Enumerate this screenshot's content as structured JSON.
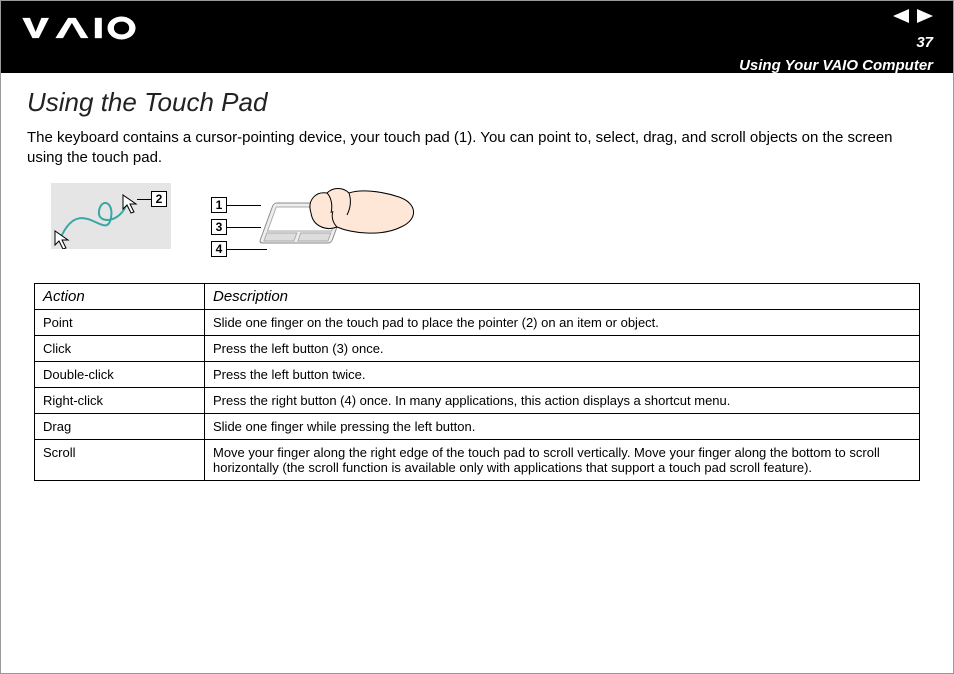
{
  "header": {
    "page_number": "37",
    "section": "Using Your VAIO Computer"
  },
  "page": {
    "title": "Using the Touch Pad",
    "intro": "The keyboard contains a cursor-pointing device, your touch pad (1). You can point to, select, drag, and scroll objects on the screen using the touch pad."
  },
  "callouts": {
    "c1": "1",
    "c2": "2",
    "c3": "3",
    "c4": "4"
  },
  "table": {
    "headers": {
      "action": "Action",
      "description": "Description"
    },
    "rows": [
      {
        "action": "Point",
        "description": "Slide one finger on the touch pad to place the pointer (2) on an item or object."
      },
      {
        "action": "Click",
        "description": "Press the left button (3) once."
      },
      {
        "action": "Double-click",
        "description": "Press the left button twice."
      },
      {
        "action": "Right-click",
        "description": "Press the right button (4) once. In many applications, this action displays a shortcut menu."
      },
      {
        "action": "Drag",
        "description": "Slide one finger while pressing the left button."
      },
      {
        "action": "Scroll",
        "description": "Move your finger along the right edge of the touch pad to scroll vertically. Move your finger along the bottom to scroll horizontally (the scroll function is available only with applications that support a touch pad scroll feature)."
      }
    ]
  }
}
